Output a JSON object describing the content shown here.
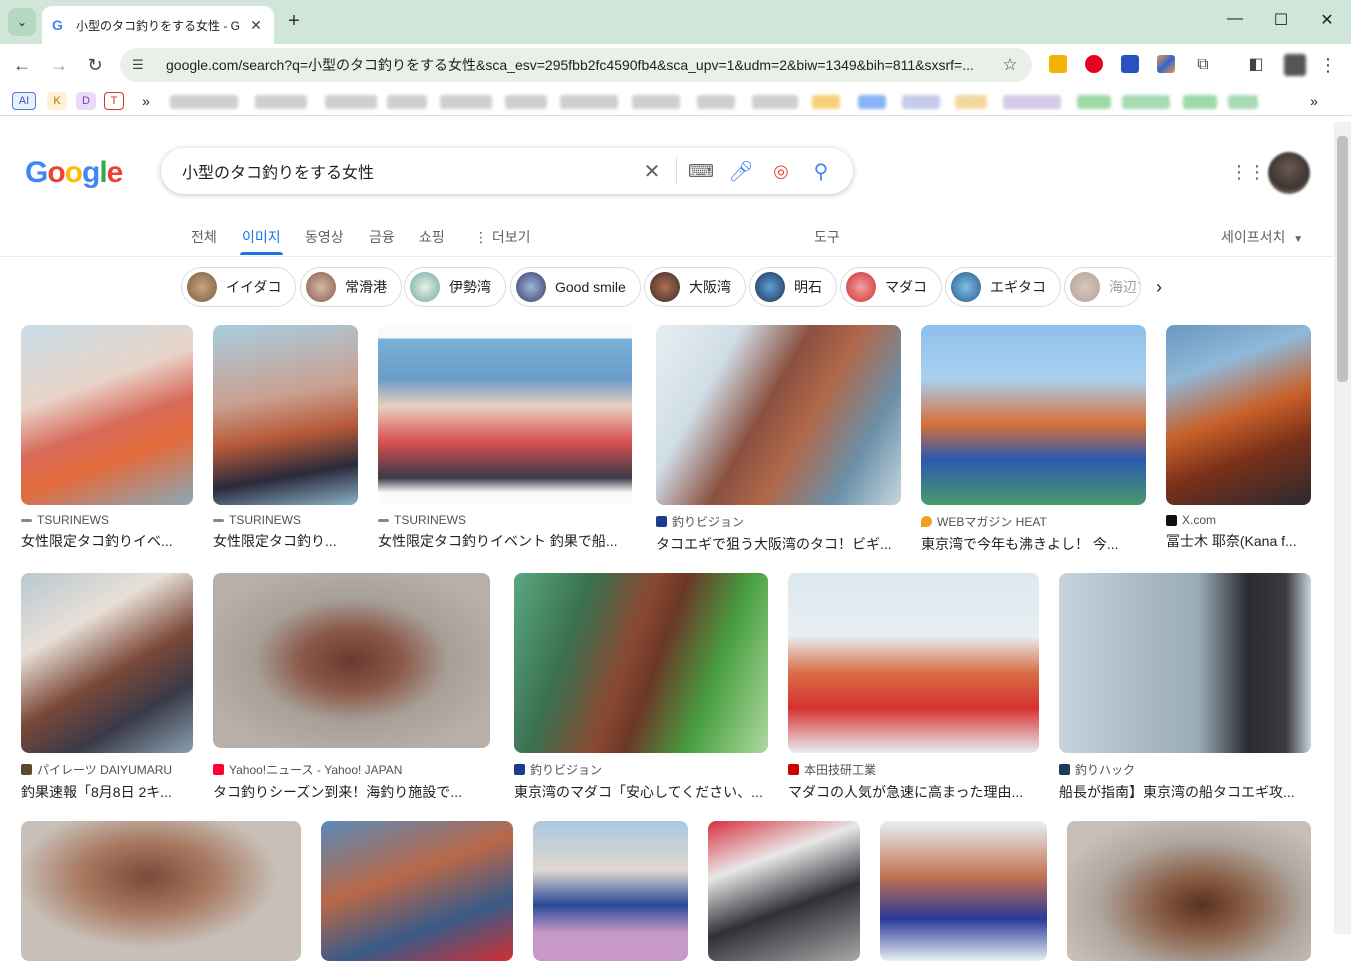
{
  "browser": {
    "tab_title": "小型のタコ釣りをする女性 - G",
    "url": "google.com/search?q=小型のタコ釣りをする女性&sca_esv=295fbb2fc4590fb4&sca_upv=1&udm=2&biw=1349&bih=811&sxsrf=...",
    "bookmarks": [
      "AI",
      "K",
      "D",
      "T"
    ]
  },
  "search": {
    "logo": "Google",
    "query": "小型のタコ釣りをする女性"
  },
  "tabs": {
    "all": "전체",
    "images": "이미지",
    "videos": "동영상",
    "finance": "금융",
    "shopping": "쇼핑",
    "more": "더보기",
    "tools": "도구",
    "safesearch": "세이프서치"
  },
  "chips": [
    "イイダコ",
    "常滑港",
    "伊勢湾",
    "Good smile",
    "大阪湾",
    "明石",
    "マダコ",
    "エギタコ",
    "海辺で"
  ],
  "results": [
    {
      "source": "TSURINEWS",
      "caption": "女性限定タコ釣りイベ..."
    },
    {
      "source": "TSURINEWS",
      "caption": "女性限定タコ釣り..."
    },
    {
      "source": "TSURINEWS",
      "caption": "女性限定タコ釣りイベント 釣果で船..."
    },
    {
      "source": "釣りビジョン",
      "caption": "タコエギで狙う大阪湾のタコ！ビギ..."
    },
    {
      "source": "WEBマガジン HEAT",
      "caption": "東京湾で今年も沸きよし！ 今..."
    },
    {
      "source": "X.com",
      "caption": "冨士木 耶奈(Kana f..."
    },
    {
      "source": "パイレーツ DAIYUMARU",
      "caption": "釣果速報「8月8日 2キ..."
    },
    {
      "source": "Yahoo!ニュース - Yahoo! JAPAN",
      "caption": "タコ釣りシーズン到来！海釣り施設で..."
    },
    {
      "source": "釣りビジョン",
      "caption": "東京湾のマダコ「安心してください、..."
    },
    {
      "source": "本田技研工業",
      "caption": "マダコの人気が急速に高まった理由..."
    },
    {
      "source": "釣りハック",
      "caption": "船長が指南】東京湾の船タコエギ攻..."
    }
  ]
}
